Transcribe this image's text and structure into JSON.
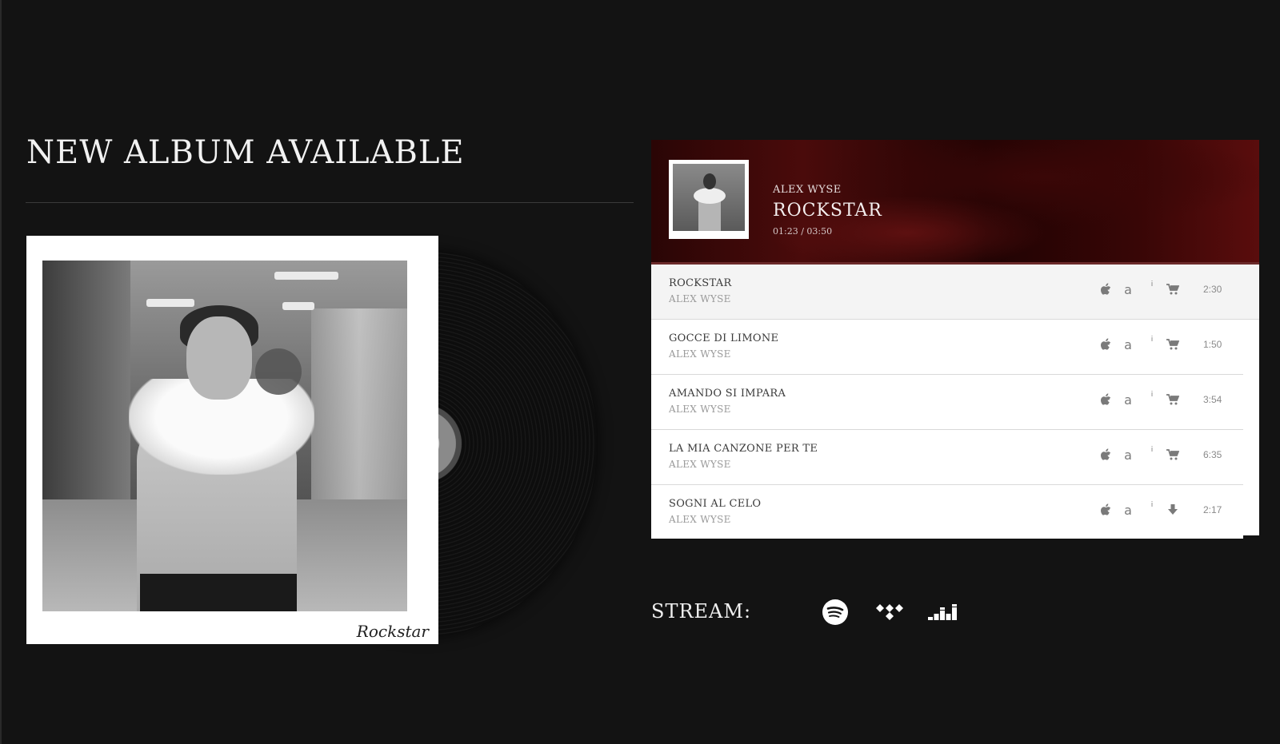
{
  "headline": "NEW ALBUM AVAILABLE",
  "cover": {
    "signature": "Rockstar"
  },
  "player": {
    "now_playing": {
      "artist": "ALEX WYSE",
      "title": "ROCKSTAR",
      "time": "01:23 / 03:50"
    },
    "tracks": [
      {
        "title": "ROCKSTAR",
        "artist": "ALEX WYSE",
        "duration": "2:30",
        "action": "cart-icon",
        "active": true
      },
      {
        "title": "GOCCE DI LIMONE",
        "artist": "ALEX WYSE",
        "duration": "1:50",
        "action": "cart-icon"
      },
      {
        "title": "AMANDO SI IMPARA",
        "artist": "ALEX WYSE",
        "duration": "3:54",
        "action": "cart-icon"
      },
      {
        "title": "LA MIA CANZONE PER TE",
        "artist": "ALEX WYSE",
        "duration": "6:35",
        "action": "cart-icon"
      },
      {
        "title": "SOGNI AL CELO",
        "artist": "ALEX WYSE",
        "duration": "2:17",
        "action": "download-icon"
      }
    ],
    "track_icons": [
      "apple-icon",
      "amazon-icon",
      "info-icon"
    ],
    "info_glyph": "i",
    "amazon_glyph": "a"
  },
  "stream": {
    "label": "STREAM:",
    "services": [
      "spotify-icon",
      "tidal-icon",
      "deezer-icon"
    ]
  },
  "colors": {
    "background": "#131313",
    "header_red": "#4a0b0b",
    "icon_gray": "#7a7a7a"
  }
}
